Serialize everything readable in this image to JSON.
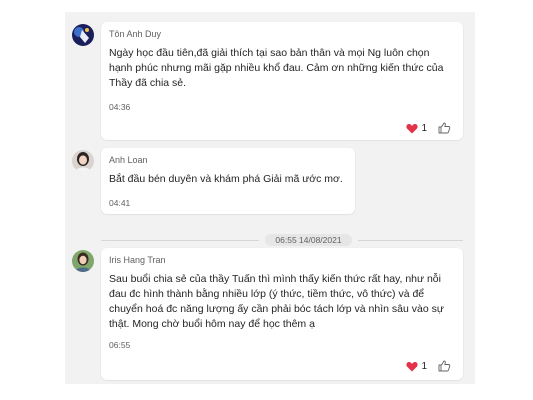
{
  "messages": [
    {
      "sender": "Tôn Anh Duy",
      "lines": [
        "Ngày học đầu tiên,đã giải thích tại sao bản thân và mọi Ng luôn chọn",
        "hạnh phúc nhưng mãi gặp nhiều khổ đau. Cảm ơn những kiến thức của",
        "Thầy đã chia sẻ."
      ],
      "time": "04:36",
      "reaction_count": "1",
      "reaction_icon": "heart-icon"
    },
    {
      "sender": "Anh Loan",
      "lines": [
        "Bắt đầu bén duyên và khám phá Giải mã ước mơ."
      ],
      "time": "04:41"
    },
    {
      "sender": "Iris Hang Tran",
      "lines": [
        "Sau buổi chia sẻ của thầy Tuấn thì mình thấy kiến thức rất hay, như nỗi",
        "đau đc hình thành bằng nhiều lớp (ý thức, tiềm thức, vô thức) và để",
        "chuyển hoá đc năng lượng ấy cần phải bóc tách lớp và nhìn sâu vào sự",
        "thật. Mong chờ buổi hôm nay để học thêm ạ"
      ],
      "time": "06:55",
      "reaction_count": "1",
      "reaction_icon": "heart-icon"
    }
  ],
  "date_divider": "06:55 14/08/2021",
  "colors": {
    "background": "#f2f2f2",
    "bubble": "#ffffff",
    "heart": "#e3334a",
    "secondary_text": "#616161"
  }
}
